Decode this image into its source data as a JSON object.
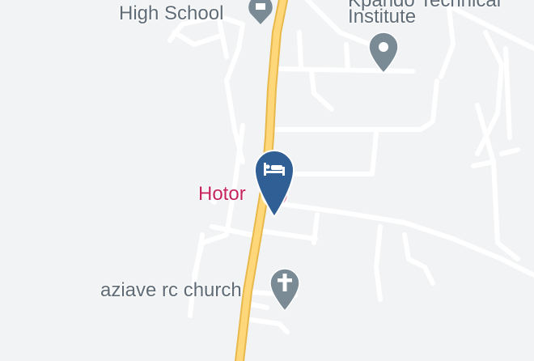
{
  "map": {
    "colors": {
      "background": "#f1f3f4",
      "road_minor": "#ffffff",
      "road_major": "#fdd77a",
      "road_major_casing": "#e9b84a",
      "poi_gray": "#7b8b96",
      "hotel_pin": "#2f5f95",
      "hotel_label": "#c5255e"
    },
    "pois": [
      {
        "id": "high-school",
        "label_line1": "High School",
        "icon": "school-icon"
      },
      {
        "id": "technical-institute",
        "label_line1": "Institute",
        "icon": "pin-icon"
      },
      {
        "id": "hotel",
        "label_line1": "Hotor",
        "icon": "bed-icon",
        "selected": true
      },
      {
        "id": "church",
        "label_line1": "aziave rc church",
        "icon": "cross-icon"
      }
    ],
    "partial_text": {
      "top_right_cut": "Kpando Technical"
    }
  }
}
